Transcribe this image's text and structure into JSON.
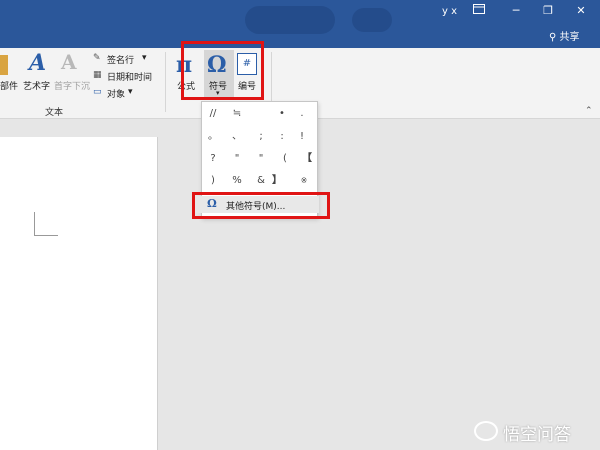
{
  "titlebar": {
    "user": "y x",
    "restore_icon": "ribbon-display-icon",
    "minimize_label": "─",
    "maximize_label": "❐",
    "close_label": "✕",
    "share_label": "共享"
  },
  "ribbon": {
    "parts_label": "部件",
    "wordart_label": "艺术字",
    "dropcap_label": "首字下沉",
    "signature_label": "签名行",
    "signature_arrow": "▾",
    "datetime_label": "日期和时间",
    "object_label": "对象",
    "object_arrow": "▾",
    "text_group_label": "文本",
    "equation_label": "公式",
    "symbol_label": "符号",
    "number_label": "编号",
    "collapse_label": "⌃"
  },
  "symbol_menu": {
    "rows": [
      [
        "//",
        "≒",
        "",
        "•",
        "."
      ],
      [
        "。",
        "、",
        ";",
        ":",
        "!"
      ],
      [
        "?",
        "\"",
        "\"",
        "(",
        "【"
      ],
      [
        ")",
        "%",
        "&",
        "】",
        "※"
      ]
    ],
    "more_label": "其他符号(M)..."
  },
  "watermark": {
    "text": "悟空问答"
  }
}
